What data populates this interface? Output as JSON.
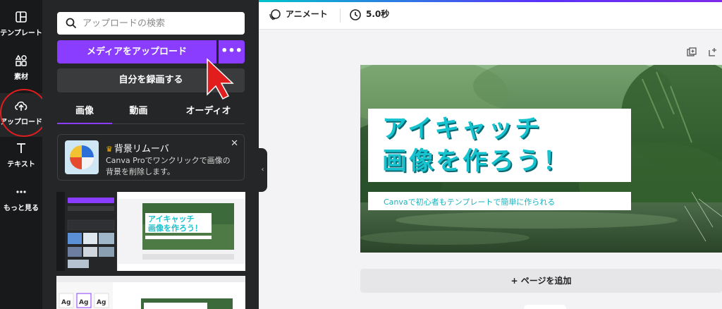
{
  "rail": {
    "items": [
      {
        "label": "テンプレート",
        "icon": "template-icon"
      },
      {
        "label": "素材",
        "icon": "elements-icon"
      },
      {
        "label": "アップロード",
        "icon": "upload-cloud-icon"
      },
      {
        "label": "テキスト",
        "icon": "text-icon"
      },
      {
        "label": "もっと見る",
        "icon": "more-dots-icon"
      }
    ]
  },
  "panel": {
    "search_placeholder": "アップロードの検索",
    "upload_button": "メディアをアップロード",
    "more_button": "•••",
    "record_button": "自分を録画する",
    "tabs": [
      "画像",
      "動画",
      "オーディオ"
    ],
    "promo": {
      "title": "背景リムーバ",
      "description": "Canva Proでワンクリックで画像の背景を削除します。",
      "close": "✕"
    },
    "collapse": "‹"
  },
  "topbar": {
    "animate": "アニメート",
    "duration": "5.0秒"
  },
  "canvas": {
    "headline_line1": "アイキャッチ",
    "headline_line2": "画像を作ろう！",
    "subtitle": "Canvaで初心者もテンプレートで簡単に作られる",
    "add_page": "+ ページを追加"
  },
  "colors": {
    "accent": "#8b3dff",
    "rail_bg": "#18191b",
    "panel_bg": "#252627",
    "headline": "#17c3cf",
    "annotation_red": "#e11d1d"
  }
}
